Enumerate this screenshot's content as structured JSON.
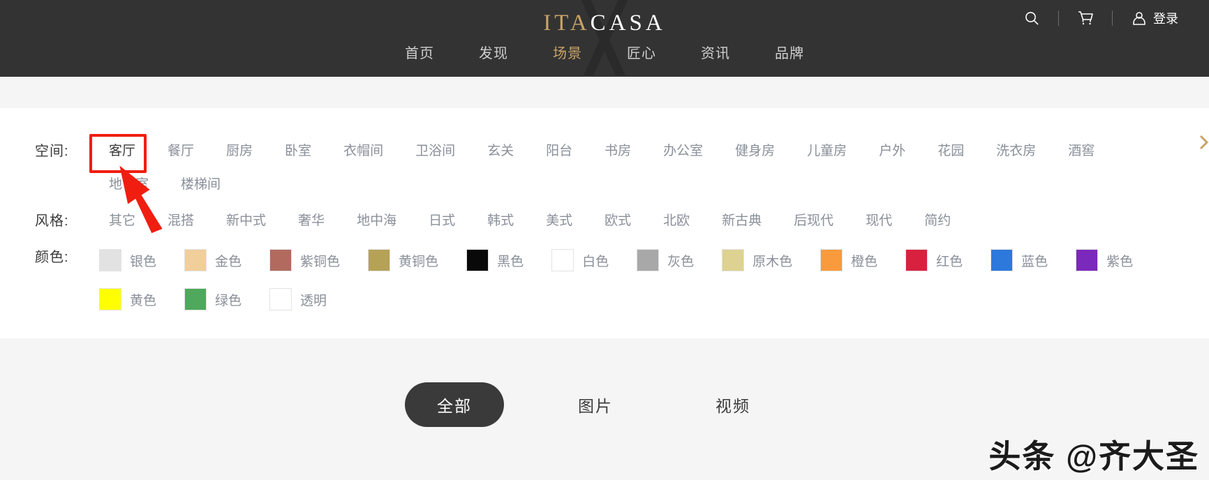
{
  "header": {
    "logo": {
      "primary": "ITA",
      "secondary": "CASA",
      "mark_icon": "x-monogram-icon"
    },
    "nav": [
      {
        "label": "首页",
        "active": false
      },
      {
        "label": "发现",
        "active": false
      },
      {
        "label": "场景",
        "active": true
      },
      {
        "label": "匠心",
        "active": false
      },
      {
        "label": "资讯",
        "active": false
      },
      {
        "label": "品牌",
        "active": false
      }
    ],
    "actions": {
      "search_icon": "search-icon",
      "cart_icon": "shopping-cart-icon",
      "user_icon": "user-account-icon",
      "login_label": "登录"
    },
    "bg_color": "#333333",
    "accent_color": "#c9a467"
  },
  "filters": {
    "space": {
      "label": "空间:",
      "items": [
        "客厅",
        "餐厅",
        "厨房",
        "卧室",
        "衣帽间",
        "卫浴间",
        "玄关",
        "阳台",
        "书房",
        "办公室",
        "健身房",
        "儿童房",
        "户外",
        "花园",
        "洗衣房",
        "酒窖",
        "地下室",
        "楼梯间"
      ],
      "selected": "客厅"
    },
    "style": {
      "label": "风格:",
      "items": [
        "其它",
        "混搭",
        "新中式",
        "奢华",
        "地中海",
        "日式",
        "韩式",
        "美式",
        "欧式",
        "北欧",
        "新古典",
        "后现代",
        "现代",
        "简约"
      ],
      "selected": null
    },
    "color": {
      "label": "颜色:",
      "items": [
        {
          "name": "银色",
          "hex": "#e2e2e2"
        },
        {
          "name": "金色",
          "hex": "#f0cf9a"
        },
        {
          "name": "紫铜色",
          "hex": "#b26a5e"
        },
        {
          "name": "黄铜色",
          "hex": "#b5a257"
        },
        {
          "name": "黑色",
          "hex": "#090909"
        },
        {
          "name": "白色",
          "hex": "#ffffff"
        },
        {
          "name": "灰色",
          "hex": "#a8a8a8"
        },
        {
          "name": "原木色",
          "hex": "#ddd291"
        },
        {
          "name": "橙色",
          "hex": "#f99a3c"
        },
        {
          "name": "红色",
          "hex": "#d8213f"
        },
        {
          "name": "蓝色",
          "hex": "#2c78dd"
        },
        {
          "name": "紫色",
          "hex": "#7b28bd"
        },
        {
          "name": "黄色",
          "hex": "#ffff00"
        },
        {
          "name": "绿色",
          "hex": "#4fa85c"
        },
        {
          "name": "透明",
          "hex": "#ffffff"
        }
      ]
    },
    "scroll_arrow_icon": "chevron-right-icon"
  },
  "tabs": [
    {
      "label": "全部",
      "active": true
    },
    {
      "label": "图片",
      "active": false
    },
    {
      "label": "视频",
      "active": false
    }
  ],
  "annotation": {
    "highlight_color": "#f01e10",
    "highlight_target": "客厅",
    "arrow_icon": "pointer-arrow-icon"
  },
  "watermark": {
    "text": "头条 @齐大圣"
  }
}
